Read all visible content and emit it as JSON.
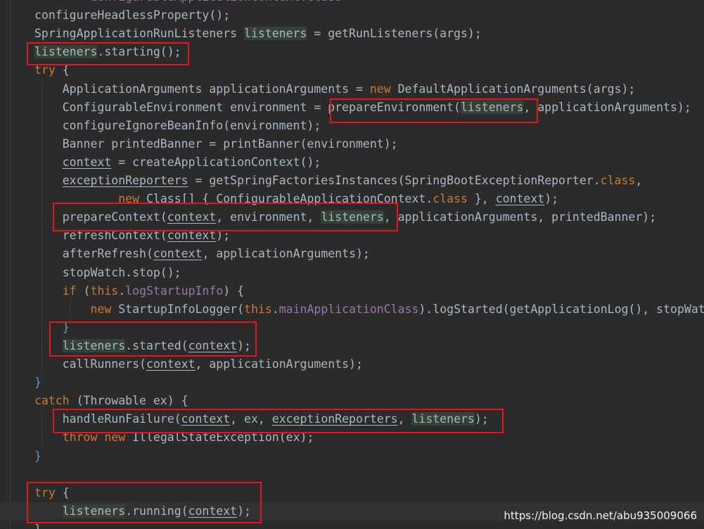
{
  "colors": {
    "background": "#2b2b2b",
    "default_text": "#a9b7c6",
    "keyword": "#cc7832",
    "field": "#9876aa",
    "paren_blue": "#6897bb",
    "usage_highlight": "#344134",
    "annotation_box": "#e8131b"
  },
  "code_lines": [
    [
      {
        "t": "        "
      },
      {
        "t": "ConfigurableApplicationContext.class",
        "c": "fld"
      }
    ],
    [
      {
        "t": "configureHeadlessProperty();"
      }
    ],
    [
      {
        "t": "SpringApplicationRunListeners "
      },
      {
        "t": "listeners",
        "c": "hl"
      },
      {
        "t": " = getRunListeners(args);"
      }
    ],
    [
      {
        "t": "listeners",
        "c": "hl"
      },
      {
        "t": ".starting();"
      }
    ],
    [
      {
        "t": "try",
        "c": "kw"
      },
      {
        "t": " {"
      }
    ],
    [
      {
        "t": "    ApplicationArguments applicationArguments = "
      },
      {
        "t": "new",
        "c": "kw"
      },
      {
        "t": " DefaultApplicationArguments(args);"
      }
    ],
    [
      {
        "t": "    ConfigurableEnvironment environment = prepareEnvironment("
      },
      {
        "t": "listeners",
        "c": "hl"
      },
      {
        "t": ", applicationArguments);"
      }
    ],
    [
      {
        "t": "    configureIgnoreBeanInfo(environment);"
      }
    ],
    [
      {
        "t": "    Banner printedBanner = printBanner(environment);"
      }
    ],
    [
      {
        "t": "    "
      },
      {
        "t": "context",
        "c": "var"
      },
      {
        "t": " = createApplicationContext();"
      }
    ],
    [
      {
        "t": "    "
      },
      {
        "t": "exceptionReporters",
        "c": "var"
      },
      {
        "t": " = getSpringFactoriesInstances(SpringBootExceptionReporter."
      },
      {
        "t": "class",
        "c": "kw"
      },
      {
        "t": ","
      }
    ],
    [
      {
        "t": "            "
      },
      {
        "t": "new",
        "c": "kw"
      },
      {
        "t": " Class[] { ConfigurableApplicationContext."
      },
      {
        "t": "class",
        "c": "kw"
      },
      {
        "t": " }, "
      },
      {
        "t": "context",
        "c": "var"
      },
      {
        "t": ");"
      }
    ],
    [
      {
        "t": "    prepareContext("
      },
      {
        "t": "context",
        "c": "var"
      },
      {
        "t": ", environment, "
      },
      {
        "t": "listeners",
        "c": "hl"
      },
      {
        "t": ", applicationArguments, printedBanner);"
      }
    ],
    [
      {
        "t": "    refreshContext("
      },
      {
        "t": "context",
        "c": "var"
      },
      {
        "t": ");"
      }
    ],
    [
      {
        "t": "    afterRefresh("
      },
      {
        "t": "context",
        "c": "var"
      },
      {
        "t": ", applicationArguments);"
      }
    ],
    [
      {
        "t": "    stopWatch.stop();"
      }
    ],
    [
      {
        "t": "    "
      },
      {
        "t": "if",
        "c": "kw"
      },
      {
        "t": " ("
      },
      {
        "t": "this",
        "c": "kw"
      },
      {
        "t": "."
      },
      {
        "t": "logStartupInfo",
        "c": "fld"
      },
      {
        "t": ") {"
      }
    ],
    [
      {
        "t": "        "
      },
      {
        "t": "new",
        "c": "kw"
      },
      {
        "t": " StartupInfoLogger("
      },
      {
        "t": "this",
        "c": "kw"
      },
      {
        "t": "."
      },
      {
        "t": "mainApplicationClass",
        "c": "fld"
      },
      {
        "t": ").logStarted(getApplicationLog(), stopWatch);"
      }
    ],
    [
      {
        "t": "    "
      },
      {
        "t": "}",
        "c": "bl"
      }
    ],
    [
      {
        "t": "    "
      },
      {
        "t": "listeners",
        "c": "hl"
      },
      {
        "t": ".started("
      },
      {
        "t": "context",
        "c": "var"
      },
      {
        "t": ");"
      }
    ],
    [
      {
        "t": "    callRunners("
      },
      {
        "t": "context",
        "c": "var"
      },
      {
        "t": ", applicationArguments);"
      }
    ],
    [
      {
        "t": "}",
        "c": "bl"
      }
    ],
    [
      {
        "t": "catch",
        "c": "kw"
      },
      {
        "t": " (Throwable ex) {"
      }
    ],
    [
      {
        "t": "    handleRunFailure("
      },
      {
        "t": "context",
        "c": "var"
      },
      {
        "t": ", ex, "
      },
      {
        "t": "exceptionReporters",
        "c": "var"
      },
      {
        "t": ", "
      },
      {
        "t": "listeners",
        "c": "hl"
      },
      {
        "t": ");"
      }
    ],
    [
      {
        "t": "    "
      },
      {
        "t": "throw",
        "c": "kw"
      },
      {
        "t": " "
      },
      {
        "t": "new",
        "c": "kw"
      },
      {
        "t": " IllegalStateException(ex);"
      }
    ],
    [
      {
        "t": "}",
        "c": "bl"
      }
    ],
    [
      {
        "t": ""
      }
    ],
    [
      {
        "t": "try",
        "c": "kw"
      },
      {
        "t": " {"
      }
    ],
    [
      {
        "t": "    "
      },
      {
        "t": "listeners",
        "c": "hl"
      },
      {
        "t": ".running("
      },
      {
        "t": "context",
        "c": "var"
      },
      {
        "t": ");"
      }
    ],
    [
      {
        "t": "}"
      }
    ]
  ],
  "watermark": "https://blog.csdn.net/abu935009066"
}
